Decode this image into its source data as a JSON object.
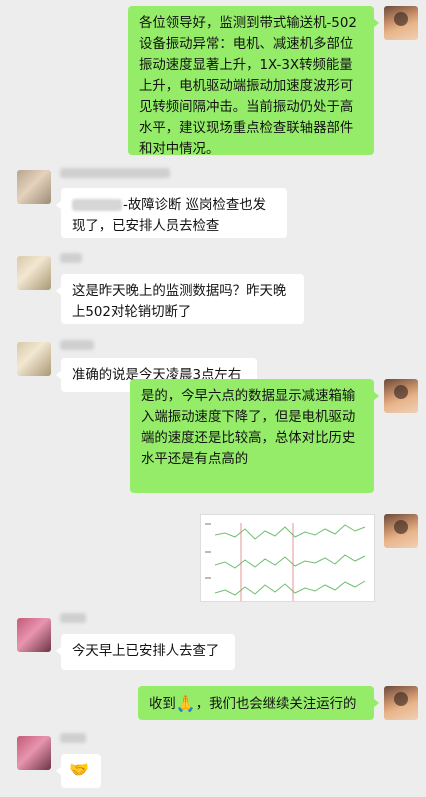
{
  "messages": [
    {
      "side": "out",
      "text": "各位领导好，监测到带式输送机-502设备振动异常：电机、减速机多部位振动速度显著上升，1X-3X转频能量上升，电机驱动端振动加速度波形可见转频间隔冲击。当前振动仍处于高水平，建议现场重点检查联轴器部件和对中情况。"
    },
    {
      "side": "in",
      "text_suffix": "-故障诊断 巡岗检查也发现了，已安排人员去检查"
    },
    {
      "side": "in",
      "text": "这是昨天晚上的监测数据吗？昨天晚上502对轮销切断了"
    },
    {
      "side": "in",
      "text": "准确的说是今天凌晨3点左右"
    },
    {
      "side": "out",
      "text": "是的，今早六点的数据显示减速箱输入端振动速度下降了，但是电机驱动端的速度还是比较高，总体对比历史水平还是有点高的"
    },
    {
      "side": "out",
      "type": "image",
      "icon": "chart-screenshot"
    },
    {
      "side": "in",
      "text": "今天早上已安排人去查了"
    },
    {
      "side": "out",
      "text": "收到",
      "emoji": "🙏",
      "text_after": "，我们也会继续关注运行的"
    },
    {
      "side": "in",
      "emoji": "🤝"
    }
  ]
}
